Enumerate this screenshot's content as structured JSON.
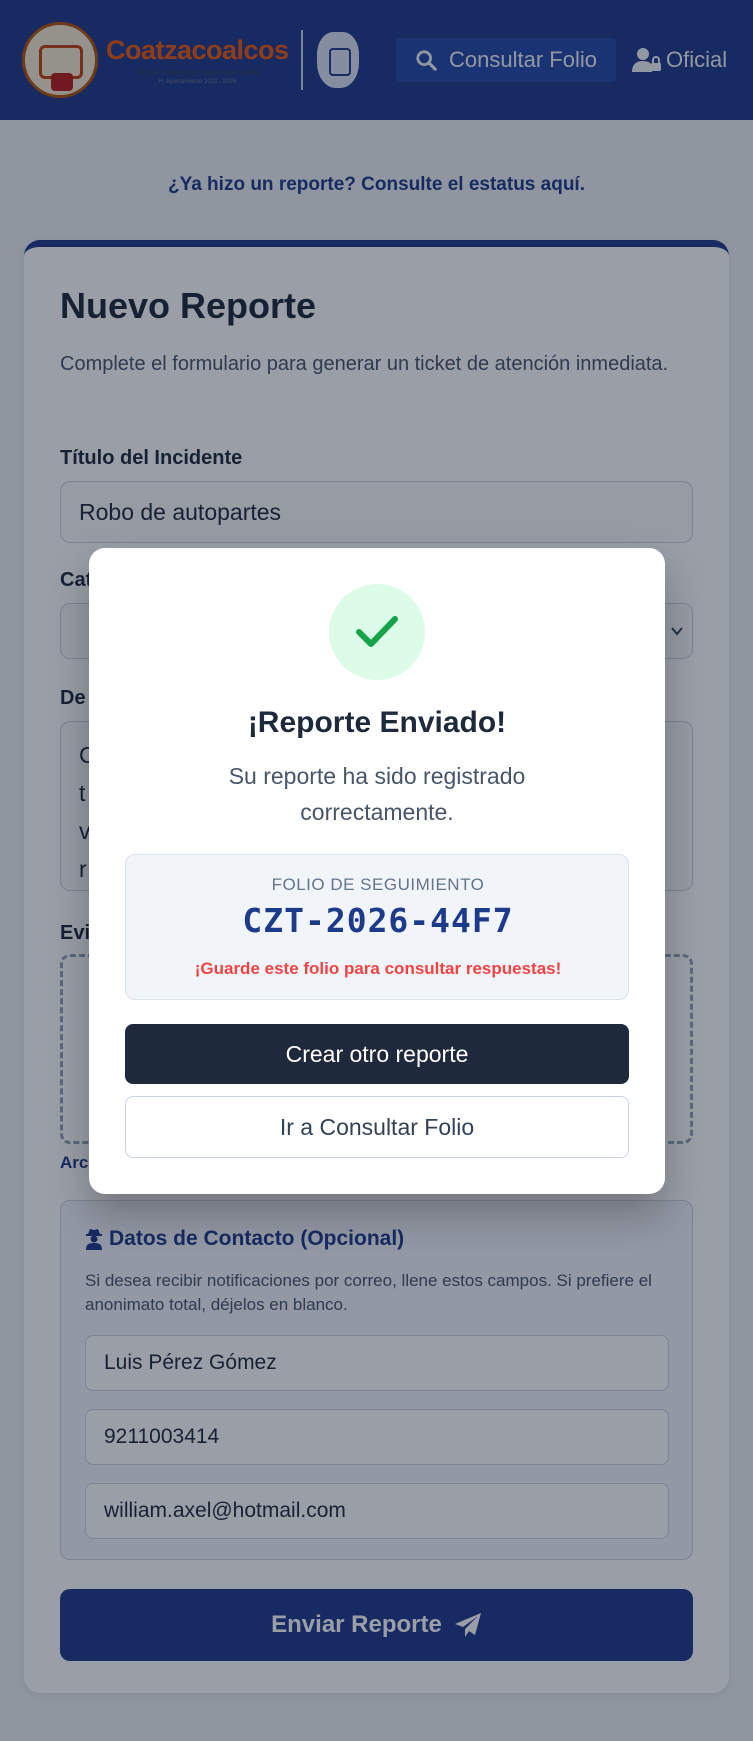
{
  "header": {
    "logo": {
      "name": "Coatzacoalcos",
      "tagline": "Por la ciudad que queremos todos",
      "sub": "H. Ayuntamiento 2022 - 2025"
    },
    "consultar_label": "Consultar Folio",
    "oficial_label": "Oficial",
    "colors": {
      "header_bg": "#1e3a8a",
      "brand_orange": "#ea580c"
    }
  },
  "status_link": "¿Ya hizo un reporte? Consulte el estatus aquí.",
  "form": {
    "title": "Nuevo Reporte",
    "subtitle": "Complete el formulario para generar un ticket de atención inmediata.",
    "titulo_label": "Título del Incidente",
    "titulo_value": "Robo de autopartes",
    "categoria_label_partial": "Cat",
    "descripcion_label_partial": "De",
    "descripcion_partial": "C\nt\nv\nr",
    "evidencia_label_partial": "Evi",
    "archivos_partial": "Arc"
  },
  "contact": {
    "title": "Datos de Contacto (Opcional)",
    "description": "Si desea recibir notificaciones por correo, llene estos campos. Si prefiere el anonimato total, déjelos en blanco.",
    "name_value": "Luis Pérez Gómez",
    "phone_value": "9211003414",
    "email_value": "william.axel@hotmail.com"
  },
  "submit_label": "Enviar Reporte",
  "modal": {
    "icon": "check-icon",
    "title": "¡Reporte Enviado!",
    "message": "Su reporte ha sido registrado correctamente.",
    "folio_label": "FOLIO DE SEGUIMIENTO",
    "folio_value": "CZT-2026-44F7",
    "folio_warning": "¡Guarde este folio para consultar respuestas!",
    "primary_button": "Crear otro reporte",
    "secondary_button": "Ir a Consultar Folio",
    "colors": {
      "success": "#16a34a",
      "warning": "#ef4444"
    }
  }
}
